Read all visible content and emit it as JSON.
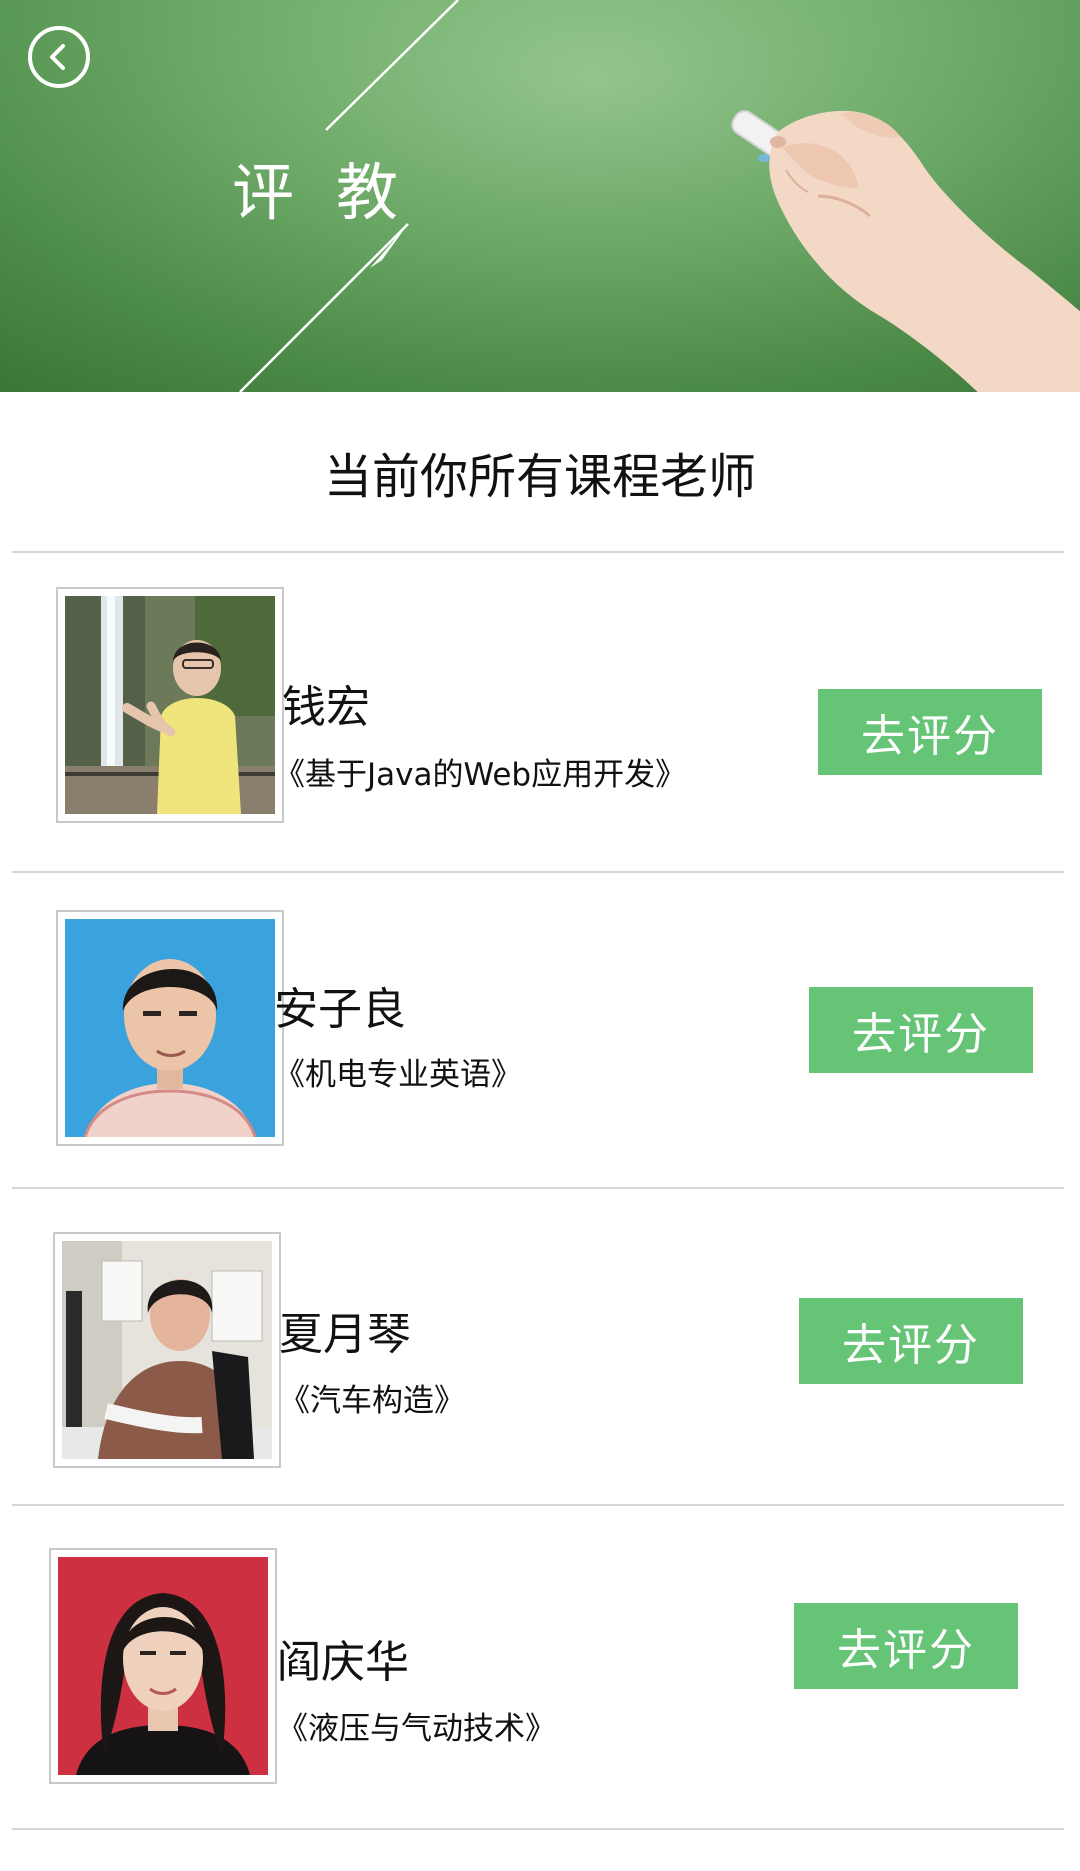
{
  "header": {
    "title": "评教",
    "back_icon": "chevron-left-icon"
  },
  "section": {
    "title": "当前你所有课程老师"
  },
  "teachers": [
    {
      "name": "钱宏",
      "course": "《基于Java的Web应用开发》",
      "action_label": "去评分"
    },
    {
      "name": "安子良",
      "course": "《机电专业英语》",
      "action_label": "去评分"
    },
    {
      "name": "夏月琴",
      "course": "《汽车构造》",
      "action_label": "去评分"
    },
    {
      "name": "阎庆华",
      "course": "《液压与气动技术》",
      "action_label": "去评分"
    }
  ],
  "colors": {
    "banner_green": "#6fae69",
    "button_green": "#66c477",
    "divider": "#d6d6d6"
  }
}
